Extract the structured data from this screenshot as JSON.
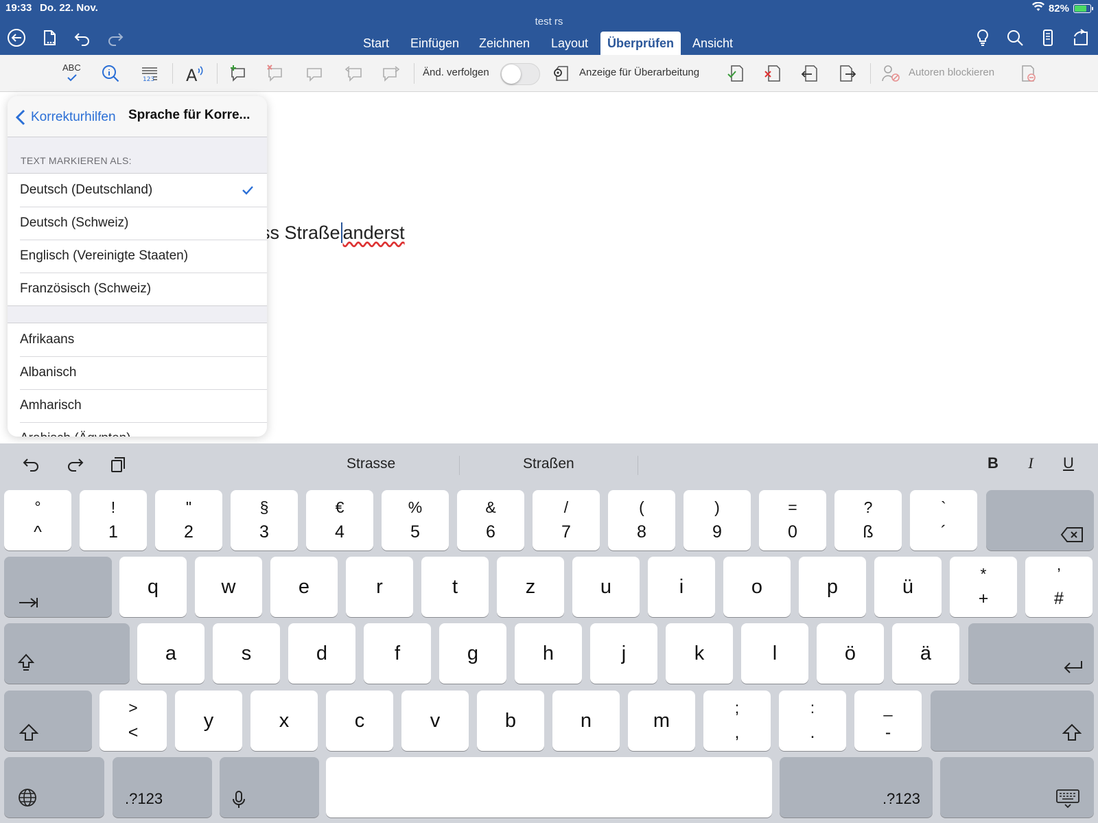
{
  "status_bar": {
    "time": "19:33",
    "date": "Do. 22. Nov.",
    "battery": "82%",
    "battery_level": 0.82
  },
  "document": {
    "title": "test rs",
    "text_before": "ss Straße",
    "text_after": "anderst"
  },
  "header": {
    "tabs": [
      {
        "label": "Start",
        "active": false
      },
      {
        "label": "Einfügen",
        "active": false
      },
      {
        "label": "Zeichnen",
        "active": false
      },
      {
        "label": "Layout",
        "active": false
      },
      {
        "label": "Überprüfen",
        "active": true
      },
      {
        "label": "Ansicht",
        "active": false
      }
    ],
    "left_icons": [
      "back-icon",
      "file-icon",
      "undo-icon",
      "redo-icon"
    ],
    "right_icons": [
      "lightbulb-icon",
      "search-icon",
      "phone-view-icon",
      "share-icon"
    ]
  },
  "ribbon": {
    "spelling_label": "ABC",
    "track_changes_label": "Änd. verfolgen",
    "track_changes_on": false,
    "markup_display_label": "Anzeige für Überarbeitung",
    "block_authors_label": "Autoren blockieren"
  },
  "popover": {
    "back_label": "Korrekturhilfen",
    "title": "Sprache für Korre...",
    "section_header": "TEXT MARKIEREN ALS:",
    "recent_languages": [
      {
        "label": "Deutsch (Deutschland)",
        "checked": true
      },
      {
        "label": "Deutsch (Schweiz)",
        "checked": false
      },
      {
        "label": "Englisch (Vereinigte Staaten)",
        "checked": false
      },
      {
        "label": "Französisch (Schweiz)",
        "checked": false
      }
    ],
    "all_languages": [
      "Afrikaans",
      "Albanisch",
      "Amharisch",
      "Arabisch (Ägypten)"
    ]
  },
  "keyboard": {
    "suggestions": [
      "Strasse",
      "Straßen"
    ],
    "format_buttons": {
      "bold": "B",
      "italic": "I",
      "underline": "U"
    },
    "number_row": [
      {
        "top": "°",
        "bottom": "^"
      },
      {
        "top": "!",
        "bottom": "1"
      },
      {
        "top": "\"",
        "bottom": "2"
      },
      {
        "top": "§",
        "bottom": "3"
      },
      {
        "top": "€",
        "bottom": "4"
      },
      {
        "top": "%",
        "bottom": "5"
      },
      {
        "top": "&",
        "bottom": "6"
      },
      {
        "top": "/",
        "bottom": "7"
      },
      {
        "top": "(",
        "bottom": "8"
      },
      {
        "top": ")",
        "bottom": "9"
      },
      {
        "top": "=",
        "bottom": "0"
      },
      {
        "top": "?",
        "bottom": "ß"
      },
      {
        "top": "`",
        "bottom": "´"
      }
    ],
    "row_q": [
      "q",
      "w",
      "e",
      "r",
      "t",
      "z",
      "u",
      "i",
      "o",
      "p",
      "ü"
    ],
    "row_q_extra": [
      {
        "top": "*",
        "bottom": "+"
      },
      {
        "top": "’",
        "bottom": "#"
      }
    ],
    "row_a": [
      "a",
      "s",
      "d",
      "f",
      "g",
      "h",
      "j",
      "k",
      "l",
      "ö",
      "ä"
    ],
    "row_y_first": {
      "top": ">",
      "bottom": "<"
    },
    "row_y": [
      "y",
      "x",
      "c",
      "v",
      "b",
      "n",
      "m"
    ],
    "row_y_extra": [
      {
        "top": ";",
        "bottom": ","
      },
      {
        "top": ":",
        "bottom": "."
      },
      {
        "top": "_",
        "bottom": "-"
      }
    ],
    "numbers_key_label": ".?123"
  }
}
